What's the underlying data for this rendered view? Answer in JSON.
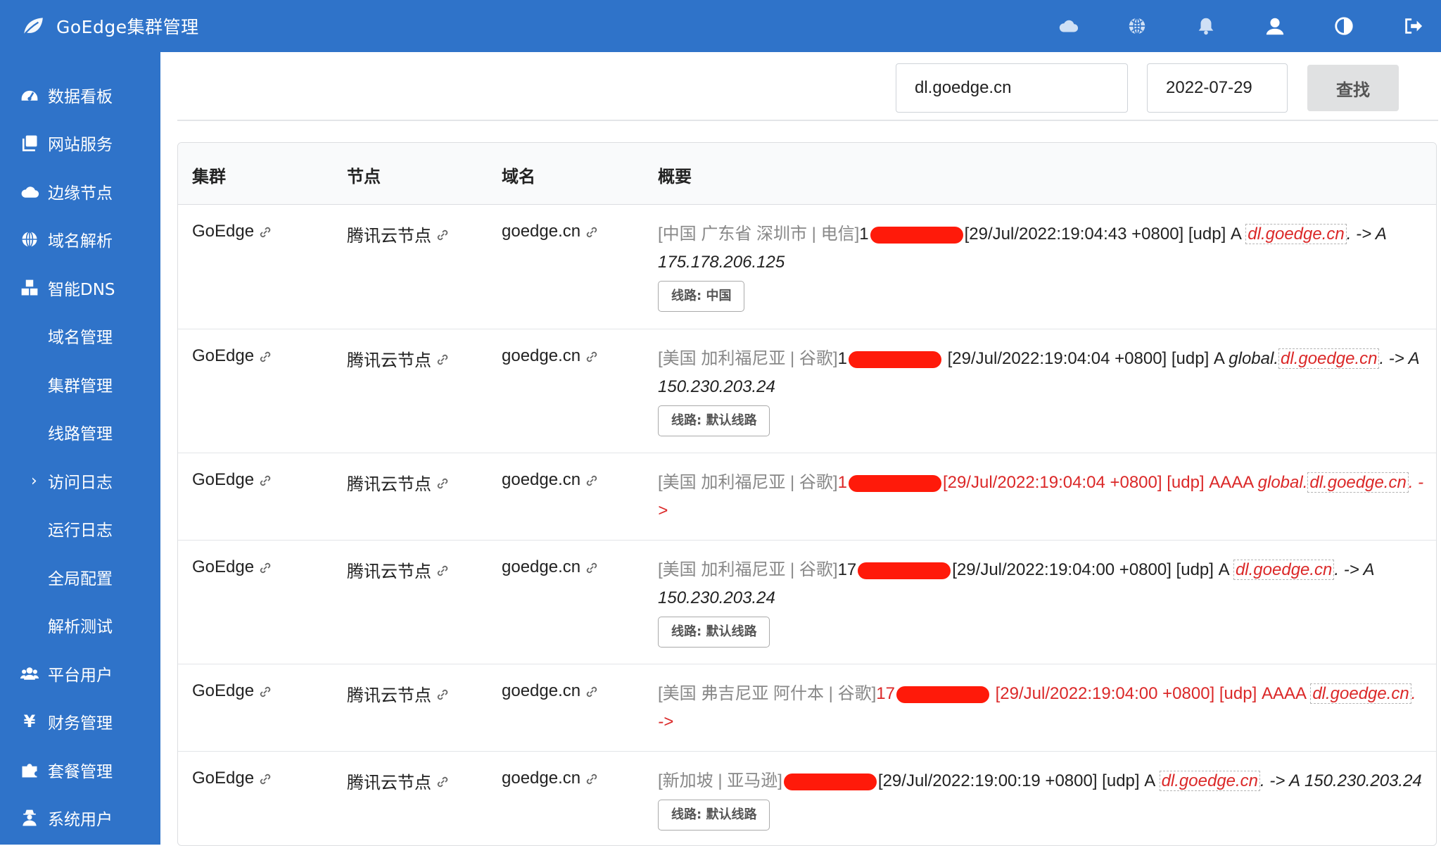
{
  "app": {
    "title": "GoEdge集群管理"
  },
  "header_icons": [
    "cloud-icon",
    "globe-icon",
    "bell-icon",
    "user-icon",
    "contrast-icon",
    "logout-icon"
  ],
  "sidebar": {
    "items": [
      {
        "label": "数据看板",
        "icon": "dashboard-icon"
      },
      {
        "label": "网站服务",
        "icon": "copy-icon"
      },
      {
        "label": "边缘节点",
        "icon": "cloud-icon"
      },
      {
        "label": "域名解析",
        "icon": "globe-icon"
      },
      {
        "label": "智能DNS",
        "icon": "cubes-icon"
      },
      {
        "label": "域名管理"
      },
      {
        "label": "集群管理"
      },
      {
        "label": "线路管理"
      },
      {
        "label": "访问日志",
        "active": true
      },
      {
        "label": "运行日志"
      },
      {
        "label": "全局配置"
      },
      {
        "label": "解析测试"
      },
      {
        "label": "平台用户",
        "icon": "users-icon"
      },
      {
        "label": "财务管理",
        "icon": "yen-icon"
      },
      {
        "label": "套餐管理",
        "icon": "puzzle-icon"
      },
      {
        "label": "系统用户",
        "icon": "user-secret-icon"
      }
    ]
  },
  "search": {
    "domain": "dl.goedge.cn",
    "date": "2022-07-29",
    "button": "查找"
  },
  "table": {
    "headers": {
      "cluster": "集群",
      "node": "节点",
      "domain": "域名",
      "summary": "概要"
    },
    "rows": [
      {
        "cluster": "GoEdge",
        "node": "腾讯云节点",
        "domain": "goedge.cn",
        "location": "[中国 广东省 深圳市 | 电信]",
        "ip_fragment": "1",
        "time": "[29/Jul/2022:19:04:43 +0800] [udp] A ",
        "prefix": "",
        "qname": "dl.goedge.cn",
        "answer": ". -> A 175.178.206.125",
        "route": "线路: 中国"
      },
      {
        "cluster": "GoEdge",
        "node": "腾讯云节点",
        "domain": "goedge.cn",
        "location": "[美国 加利福尼亚 | 谷歌]",
        "ip_fragment": "1",
        "time": " [29/Jul/2022:19:04:04 +0800] [udp] A ",
        "prefix": "global.",
        "qname": "dl.goedge.cn",
        "answer": ". -> A 150.230.203.24",
        "route": "线路: 默认线路"
      },
      {
        "cluster": "GoEdge",
        "node": "腾讯云节点",
        "domain": "goedge.cn",
        "location": "[美国 加利福尼亚 | 谷歌]",
        "ip_fragment": "1",
        "time": "[29/Jul/2022:19:04:04 +0800] [udp] AAAA ",
        "prefix": "global.",
        "qname": "dl.goedge.cn",
        "answer": ". ->",
        "route": "",
        "error": true
      },
      {
        "cluster": "GoEdge",
        "node": "腾讯云节点",
        "domain": "goedge.cn",
        "location": "[美国 加利福尼亚 | 谷歌]",
        "ip_fragment": "17",
        "time": "[29/Jul/2022:19:04:00 +0800] [udp] A ",
        "prefix": "",
        "qname": "dl.goedge.cn",
        "answer": ". -> A 150.230.203.24",
        "route": "线路: 默认线路"
      },
      {
        "cluster": "GoEdge",
        "node": "腾讯云节点",
        "domain": "goedge.cn",
        "location": "[美国 弗吉尼亚 阿什本 | 谷歌]",
        "ip_fragment": "17",
        "time": " [29/Jul/2022:19:04:00 +0800] [udp] AAAA ",
        "prefix": "",
        "qname": "dl.goedge.cn",
        "answer": ". ->",
        "route": "",
        "error": true
      },
      {
        "cluster": "GoEdge",
        "node": "腾讯云节点",
        "domain": "goedge.cn",
        "location": "[新加坡 | 亚马逊]",
        "ip_fragment": "",
        "time": "[29/Jul/2022:19:00:19 +0800] [udp] A ",
        "prefix": "",
        "qname": "dl.goedge.cn",
        "answer": ". -> A 150.230.203.24",
        "route": "线路: 默认线路"
      }
    ]
  },
  "colors": {
    "sidebar": "#2f73c9",
    "highlight": "#db2828",
    "redaction": "#ff1a0a"
  }
}
